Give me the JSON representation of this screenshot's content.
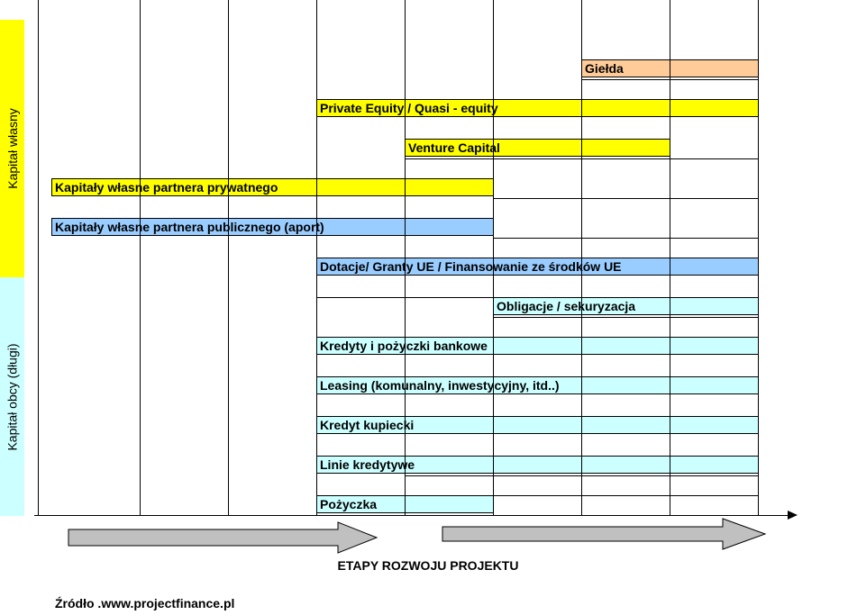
{
  "side_labels": {
    "equity": "Kapitał własny",
    "debt": "Kapitał obcy (długi)"
  },
  "colors": {
    "yellow": "#ffff00",
    "blue": "#99ccff",
    "cyan": "#ccffff",
    "orange": "#ffcc99",
    "arrow_fill": "#c0c0c0"
  },
  "bars": [
    {
      "id": "gielda",
      "label": "Giełda",
      "color": "orange"
    },
    {
      "id": "private-equity",
      "label": "Private Equity / Quasi - equity",
      "color": "yellow"
    },
    {
      "id": "venture-capital",
      "label": "Venture Capital",
      "color": "yellow"
    },
    {
      "id": "kapitaly-prywatnego",
      "label": "Kapitały własne partnera prywatnego",
      "color": "yellow"
    },
    {
      "id": "kapitaly-publicznego",
      "label": "Kapitały własne partnera publicznego (aport)",
      "color": "blue"
    },
    {
      "id": "dotacje",
      "label": "Dotacje/ Granty UE / Finansowanie ze środków UE",
      "color": "blue"
    },
    {
      "id": "obligacje",
      "label": "Obligacje / sekuryzacja",
      "color": "cyan"
    },
    {
      "id": "kredyty",
      "label": "Kredyty i pożyczki bankowe",
      "color": "cyan"
    },
    {
      "id": "leasing",
      "label": "Leasing (komunalny, inwestycyjny, itd..)",
      "color": "cyan"
    },
    {
      "id": "kredyt-kupiecki",
      "label": "Kredyt kupiecki",
      "color": "cyan"
    },
    {
      "id": "linie-kredytowe",
      "label": "Linie kredytywe",
      "color": "cyan"
    },
    {
      "id": "pozyczka",
      "label": "Pożyczka",
      "color": "cyan"
    }
  ],
  "axis_title": "ETAPY ROZWOJU PROJEKTU",
  "source": "Źródło .www.projectfinance.pl"
}
